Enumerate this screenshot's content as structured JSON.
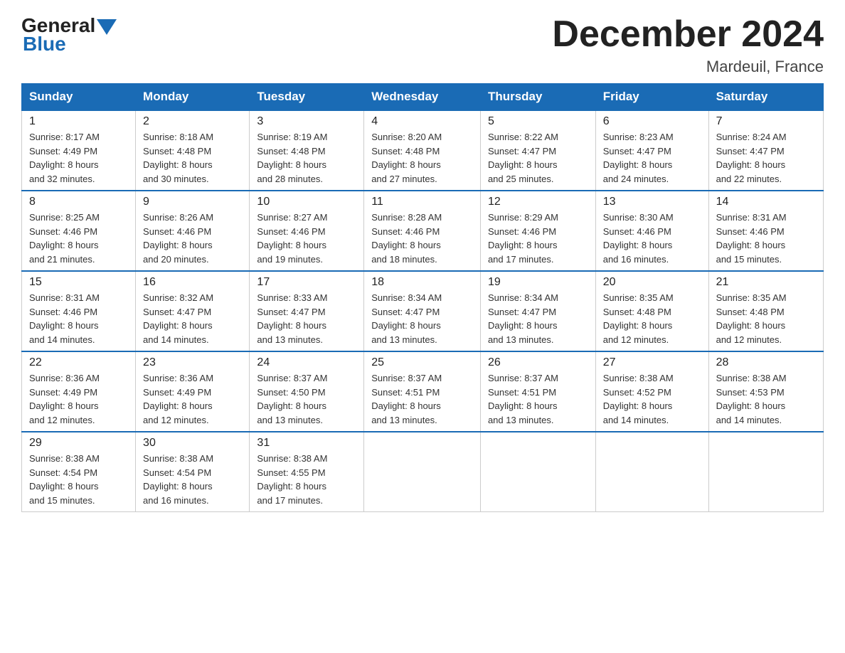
{
  "logo": {
    "general": "General",
    "blue": "Blue",
    "arrow_color": "#1a6bb5"
  },
  "title": "December 2024",
  "location": "Mardeuil, France",
  "days_header": [
    "Sunday",
    "Monday",
    "Tuesday",
    "Wednesday",
    "Thursday",
    "Friday",
    "Saturday"
  ],
  "weeks": [
    [
      {
        "date": "1",
        "sunrise": "8:17 AM",
        "sunset": "4:49 PM",
        "daylight": "8 hours and 32 minutes."
      },
      {
        "date": "2",
        "sunrise": "8:18 AM",
        "sunset": "4:48 PM",
        "daylight": "8 hours and 30 minutes."
      },
      {
        "date": "3",
        "sunrise": "8:19 AM",
        "sunset": "4:48 PM",
        "daylight": "8 hours and 28 minutes."
      },
      {
        "date": "4",
        "sunrise": "8:20 AM",
        "sunset": "4:48 PM",
        "daylight": "8 hours and 27 minutes."
      },
      {
        "date": "5",
        "sunrise": "8:22 AM",
        "sunset": "4:47 PM",
        "daylight": "8 hours and 25 minutes."
      },
      {
        "date": "6",
        "sunrise": "8:23 AM",
        "sunset": "4:47 PM",
        "daylight": "8 hours and 24 minutes."
      },
      {
        "date": "7",
        "sunrise": "8:24 AM",
        "sunset": "4:47 PM",
        "daylight": "8 hours and 22 minutes."
      }
    ],
    [
      {
        "date": "8",
        "sunrise": "8:25 AM",
        "sunset": "4:46 PM",
        "daylight": "8 hours and 21 minutes."
      },
      {
        "date": "9",
        "sunrise": "8:26 AM",
        "sunset": "4:46 PM",
        "daylight": "8 hours and 20 minutes."
      },
      {
        "date": "10",
        "sunrise": "8:27 AM",
        "sunset": "4:46 PM",
        "daylight": "8 hours and 19 minutes."
      },
      {
        "date": "11",
        "sunrise": "8:28 AM",
        "sunset": "4:46 PM",
        "daylight": "8 hours and 18 minutes."
      },
      {
        "date": "12",
        "sunrise": "8:29 AM",
        "sunset": "4:46 PM",
        "daylight": "8 hours and 17 minutes."
      },
      {
        "date": "13",
        "sunrise": "8:30 AM",
        "sunset": "4:46 PM",
        "daylight": "8 hours and 16 minutes."
      },
      {
        "date": "14",
        "sunrise": "8:31 AM",
        "sunset": "4:46 PM",
        "daylight": "8 hours and 15 minutes."
      }
    ],
    [
      {
        "date": "15",
        "sunrise": "8:31 AM",
        "sunset": "4:46 PM",
        "daylight": "8 hours and 14 minutes."
      },
      {
        "date": "16",
        "sunrise": "8:32 AM",
        "sunset": "4:47 PM",
        "daylight": "8 hours and 14 minutes."
      },
      {
        "date": "17",
        "sunrise": "8:33 AM",
        "sunset": "4:47 PM",
        "daylight": "8 hours and 13 minutes."
      },
      {
        "date": "18",
        "sunrise": "8:34 AM",
        "sunset": "4:47 PM",
        "daylight": "8 hours and 13 minutes."
      },
      {
        "date": "19",
        "sunrise": "8:34 AM",
        "sunset": "4:47 PM",
        "daylight": "8 hours and 13 minutes."
      },
      {
        "date": "20",
        "sunrise": "8:35 AM",
        "sunset": "4:48 PM",
        "daylight": "8 hours and 12 minutes."
      },
      {
        "date": "21",
        "sunrise": "8:35 AM",
        "sunset": "4:48 PM",
        "daylight": "8 hours and 12 minutes."
      }
    ],
    [
      {
        "date": "22",
        "sunrise": "8:36 AM",
        "sunset": "4:49 PM",
        "daylight": "8 hours and 12 minutes."
      },
      {
        "date": "23",
        "sunrise": "8:36 AM",
        "sunset": "4:49 PM",
        "daylight": "8 hours and 12 minutes."
      },
      {
        "date": "24",
        "sunrise": "8:37 AM",
        "sunset": "4:50 PM",
        "daylight": "8 hours and 13 minutes."
      },
      {
        "date": "25",
        "sunrise": "8:37 AM",
        "sunset": "4:51 PM",
        "daylight": "8 hours and 13 minutes."
      },
      {
        "date": "26",
        "sunrise": "8:37 AM",
        "sunset": "4:51 PM",
        "daylight": "8 hours and 13 minutes."
      },
      {
        "date": "27",
        "sunrise": "8:38 AM",
        "sunset": "4:52 PM",
        "daylight": "8 hours and 14 minutes."
      },
      {
        "date": "28",
        "sunrise": "8:38 AM",
        "sunset": "4:53 PM",
        "daylight": "8 hours and 14 minutes."
      }
    ],
    [
      {
        "date": "29",
        "sunrise": "8:38 AM",
        "sunset": "4:54 PM",
        "daylight": "8 hours and 15 minutes."
      },
      {
        "date": "30",
        "sunrise": "8:38 AM",
        "sunset": "4:54 PM",
        "daylight": "8 hours and 16 minutes."
      },
      {
        "date": "31",
        "sunrise": "8:38 AM",
        "sunset": "4:55 PM",
        "daylight": "8 hours and 17 minutes."
      },
      null,
      null,
      null,
      null
    ]
  ],
  "sunrise_label": "Sunrise:",
  "sunset_label": "Sunset:",
  "daylight_label": "Daylight:"
}
